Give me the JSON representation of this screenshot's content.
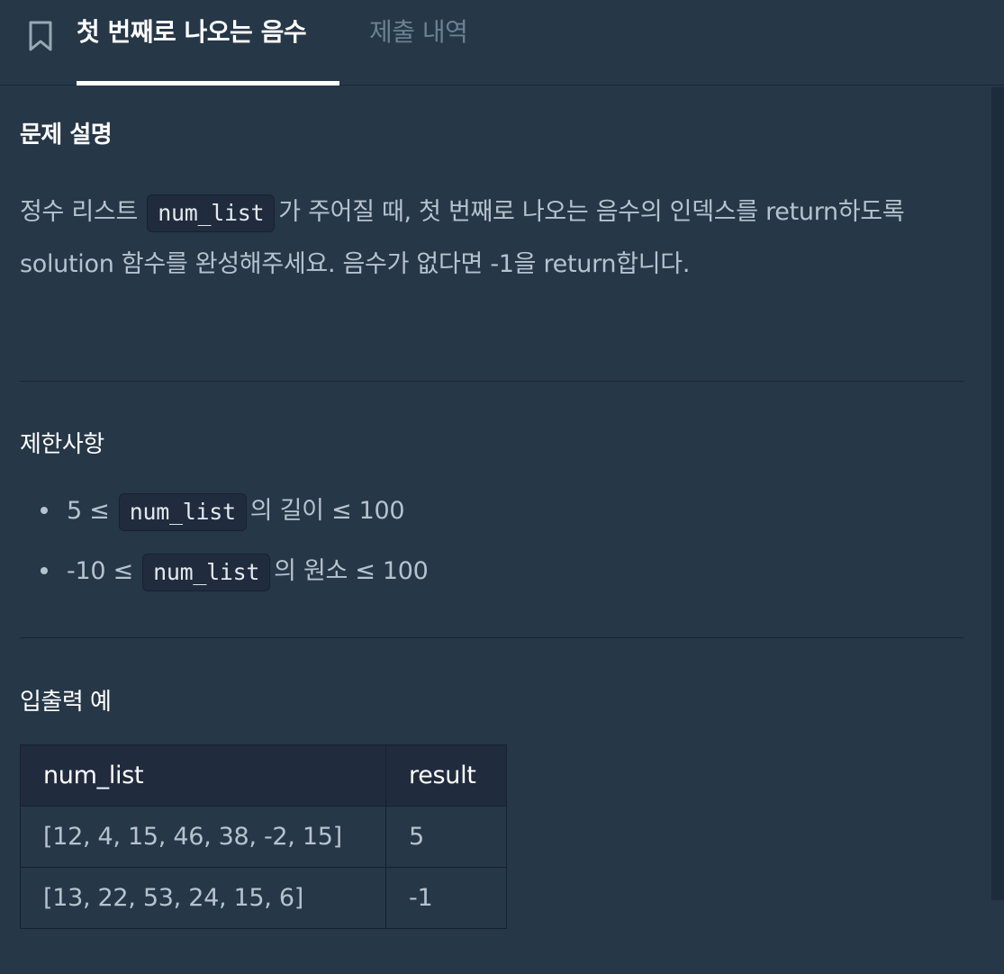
{
  "header": {
    "tabs": [
      {
        "label": "첫 번째로 나오는 음수",
        "active": true
      },
      {
        "label": "제출 내역",
        "active": false
      }
    ],
    "bookmark_icon": "bookmark-icon"
  },
  "description": {
    "title": "문제 설명",
    "text_part1": "정수 리스트",
    "code": "num_list",
    "text_part2": "가 주어질 때, 첫 번째로 나오는 음수의 인덱스를 return하도록 solution 함수를 완성해주세요. 음수가 없다면 -1을 return합니다."
  },
  "constraints": {
    "title": "제한사항",
    "items": [
      {
        "before": "5 ≤",
        "code": "num_list",
        "after": "의 길이 ≤ 100"
      },
      {
        "before": "-10 ≤",
        "code": "num_list",
        "after": "의 원소 ≤ 100"
      }
    ]
  },
  "examples": {
    "title": "입출력 예",
    "headers": [
      "num_list",
      "result"
    ],
    "rows": [
      [
        "[12, 4, 15, 46, 38, -2, 15]",
        "5"
      ],
      [
        "[13, 22, 53, 24, 15, 6]",
        "-1"
      ]
    ]
  },
  "colors": {
    "background": "#263747",
    "header_cell": "#202b3d",
    "active_tab": "#ffffff",
    "inactive_tab": "#6c8193",
    "body_text": "#b6c2cf"
  }
}
